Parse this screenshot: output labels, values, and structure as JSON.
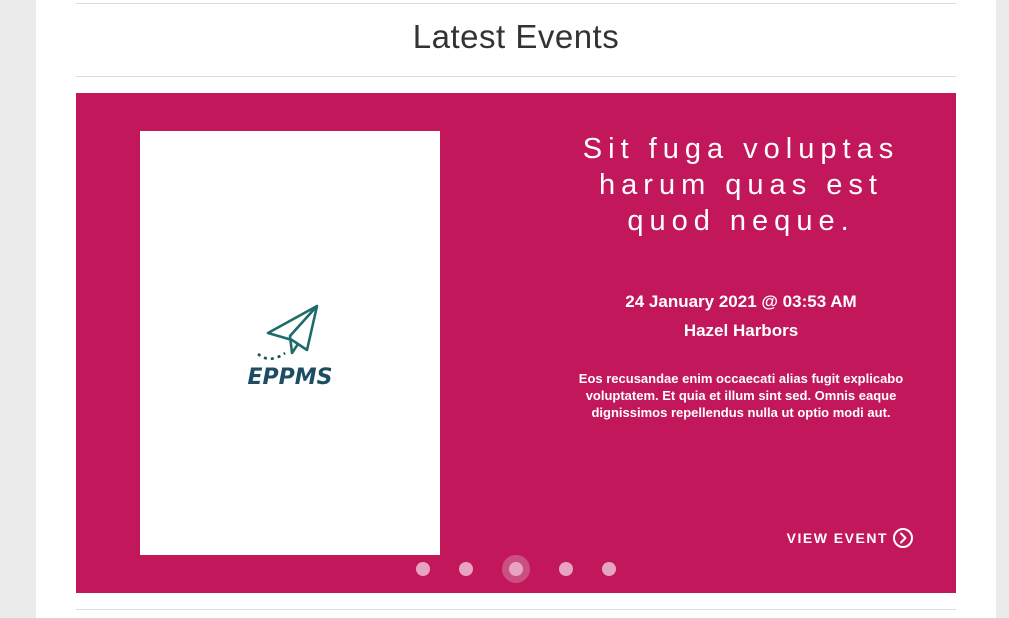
{
  "section": {
    "title": "Latest Events"
  },
  "event": {
    "title": "Sit fuga voluptas harum quas est quod neque.",
    "date": "24 January 2021 @ 03:53 AM",
    "venue": "Hazel Harbors",
    "description": "Eos recusandae enim occaecati alias fugit explicabo voluptatem. Et quia et illum sint sed. Omnis eaque dignissimos repellendus nulla ut optio modi aut.",
    "view_label": "VIEW EVENT"
  },
  "logo": {
    "text": "EPPMS",
    "icon": "paper-plane-icon"
  },
  "slider": {
    "slide_count": 5,
    "active_slide": 3
  },
  "colors": {
    "accent": "#c2185b",
    "logo": "#1d4d63"
  }
}
